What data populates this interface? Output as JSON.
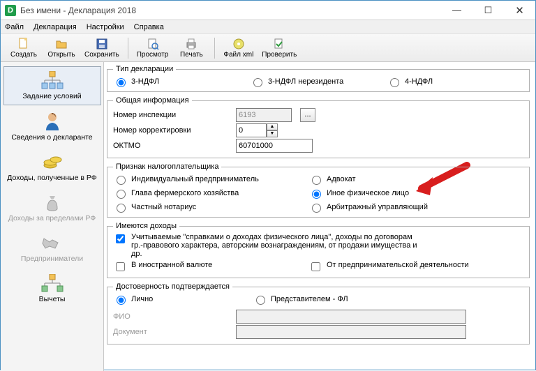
{
  "window": {
    "title": "Без имени - Декларация 2018",
    "app_icon_letter": "D"
  },
  "menubar": {
    "file": "Файл",
    "declaration": "Декларация",
    "settings": "Настройки",
    "help": "Справка"
  },
  "toolbar": {
    "create": "Создать",
    "open": "Открыть",
    "save": "Сохранить",
    "preview": "Просмотр",
    "print": "Печать",
    "file_xml": "Файл xml",
    "check": "Проверить"
  },
  "sidebar": {
    "items": [
      {
        "label": "Задание условий"
      },
      {
        "label": "Сведения о декларанте"
      },
      {
        "label": "Доходы, полученные в РФ"
      },
      {
        "label": "Доходы за пределами РФ"
      },
      {
        "label": "Предприниматели"
      },
      {
        "label": "Вычеты"
      }
    ]
  },
  "form": {
    "decl_type": {
      "legend": "Тип декларации",
      "opt1": "3-НДФЛ",
      "opt2": "3-НДФЛ нерезидента",
      "opt3": "4-НДФЛ"
    },
    "general": {
      "legend": "Общая информация",
      "inspection_label": "Номер инспекции",
      "inspection_value": "6193",
      "ellipsis": "...",
      "correction_label": "Номер корректировки",
      "correction_value": "0",
      "oktmo_label": "ОКТМО",
      "oktmo_value": "60701000"
    },
    "taxpayer": {
      "legend": "Признак налогоплательщика",
      "opt_ip": "Индивидуальный предприниматель",
      "opt_advokat": "Адвокат",
      "opt_ferm": "Глава фермерского хозяйства",
      "opt_phys": "Иное физическое лицо",
      "opt_notary": "Частный нотариус",
      "opt_arbitr": "Арбитражный управляющий"
    },
    "income": {
      "legend": "Имеются доходы",
      "chk_main": "Учитываемые \"справками о доходах физического лица\", доходы по договорам гр.-правового характера, авторским вознаграждениям, от продажи имущества и др.",
      "chk_foreign": "В иностранной валюте",
      "chk_biz": "От предпринимательской деятельности"
    },
    "confirm": {
      "legend": "Достоверность подтверждается",
      "opt_self": "Лично",
      "opt_repr": "Представителем - ФЛ",
      "fio_label": "ФИО",
      "doc_label": "Документ"
    }
  }
}
